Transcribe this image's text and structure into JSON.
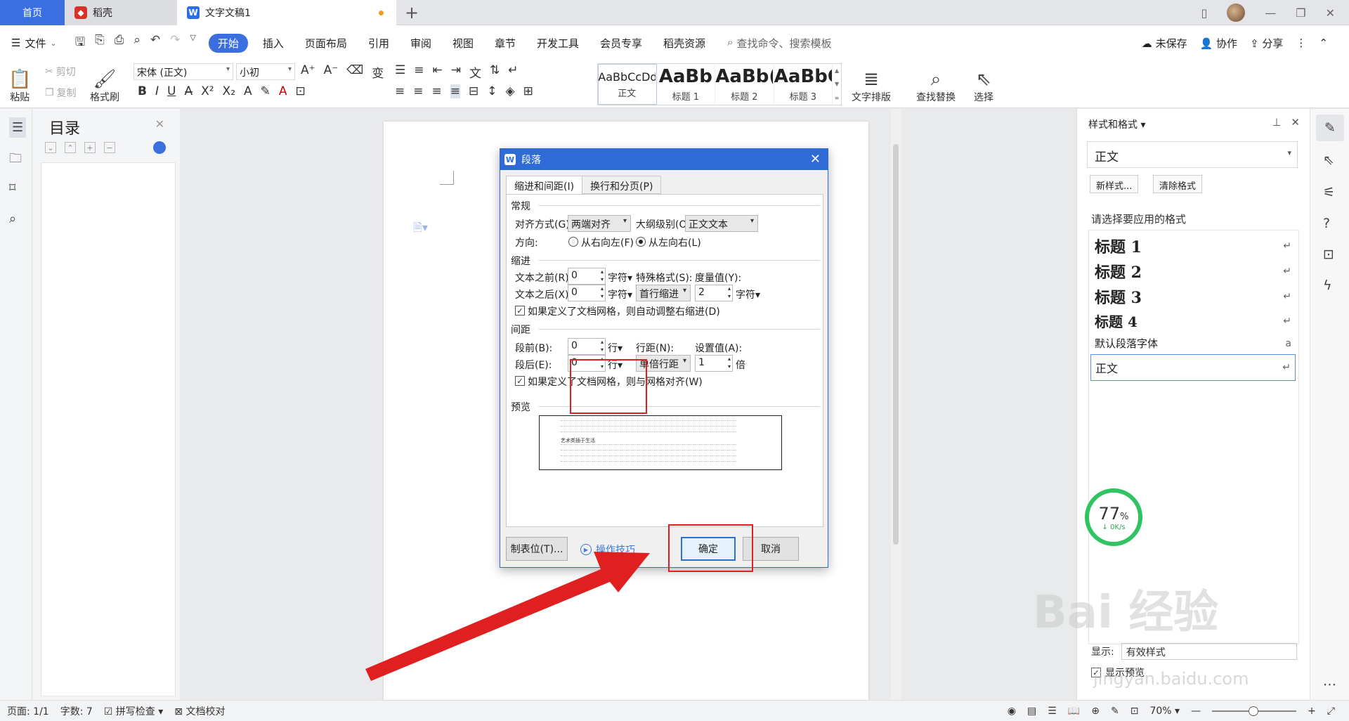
{
  "tabs": {
    "home": "首页",
    "daoke": "稻壳",
    "doc": "文字文稿1",
    "new_tab": "+"
  },
  "menu": {
    "file": "文件",
    "items": [
      "开始",
      "插入",
      "页面布局",
      "引用",
      "审阅",
      "视图",
      "章节",
      "开发工具",
      "会员专享",
      "稻壳资源"
    ],
    "search": "查找命令、搜索模板",
    "unsaved": "未保存",
    "collab": "协作",
    "share": "分享"
  },
  "ribbon": {
    "paste": "粘贴",
    "cut": "剪切",
    "copy": "复制",
    "format_painter": "格式刷",
    "font_name": "宋体 (正文)",
    "font_size": "小初",
    "styles": [
      {
        "preview": "AaBbCcDd",
        "name": "正文"
      },
      {
        "preview": "AaBb",
        "name": "标题 1"
      },
      {
        "preview": "AaBb(",
        "name": "标题 2"
      },
      {
        "preview": "AaBbC",
        "name": "标题 3"
      }
    ],
    "text_layout": "文字排版",
    "find_replace": "查找替换",
    "select": "选择"
  },
  "toc": {
    "title": "目录"
  },
  "dialog": {
    "title": "段落",
    "tabs": [
      "缩进和间距(I)",
      "换行和分页(P)"
    ],
    "general": "常规",
    "alignment_label": "对齐方式(G):",
    "alignment_value": "两端对齐",
    "outline_label": "大纲级别(O):",
    "outline_value": "正文文本",
    "direction_label": "方向:",
    "rtl": "从右向左(F)",
    "ltr": "从左向右(L)",
    "indent": "缩进",
    "before_text_label": "文本之前(R):",
    "before_text_value": "0",
    "after_text_label": "文本之后(X):",
    "after_text_value": "0",
    "char_unit": "字符",
    "special_label": "特殊格式(S):",
    "special_value": "首行缩进",
    "measure_label": "度量值(Y):",
    "measure_value": "2",
    "auto_indent_check": "如果定义了文档网格，则自动调整右缩进(D)",
    "spacing": "间距",
    "before_label": "段前(B):",
    "before_value": "0",
    "after_label": "段后(E):",
    "after_value": "0",
    "line_unit": "行",
    "line_spacing_label": "行距(N):",
    "line_spacing_value": "单倍行距",
    "set_value_label": "设置值(A):",
    "set_value": "1",
    "times_unit": "倍",
    "grid_check": "如果定义了文档网格，则与网格对齐(W)",
    "preview": "预览",
    "preview_sample": "艺术类插于生活",
    "tabs_button": "制表位(T)...",
    "tips": "操作技巧",
    "ok": "确定",
    "cancel": "取消"
  },
  "right_panel": {
    "title": "样式和格式",
    "current_style": "正文",
    "new_style": "新样式...",
    "clear_format": "清除格式",
    "apply_label": "请选择要应用的格式",
    "styles": [
      {
        "label": "标题  1",
        "mark": "↵"
      },
      {
        "label": "标题  2",
        "mark": "↵"
      },
      {
        "label": "标题  3",
        "mark": "↵"
      },
      {
        "label": "标题  4",
        "mark": "↵"
      },
      {
        "label": "默认段落字体",
        "mark": "a"
      },
      {
        "label": "正文",
        "mark": "↵"
      }
    ],
    "show_label": "显示:",
    "show_value": "有效样式",
    "show_preview": "显示预览"
  },
  "speed": {
    "percent": "77",
    "unit": "%",
    "rate": "0K/s"
  },
  "status": {
    "page": "页面: 1/1",
    "words": "字数: 7",
    "spell": "拼写检查",
    "proof": "文档校对",
    "zoom": "70%"
  },
  "watermark": {
    "brand": "Bai 经验",
    "url": "jingyan.baidu.com"
  },
  "colors": {
    "accent": "#3b6fe0",
    "dialog_title": "#2f6bd6",
    "annotation_red": "#e02020",
    "speed_ring": "#2fc461"
  }
}
